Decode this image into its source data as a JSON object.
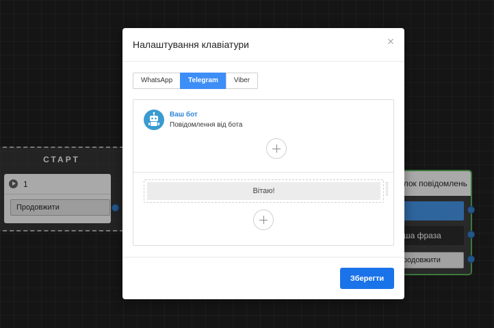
{
  "canvas": {
    "start_node": {
      "title": "СТАРТ",
      "step_number": "1",
      "continue_label": "Продовжити"
    },
    "right_node": {
      "header": "Блок повідомлень",
      "phrase": "Інша фраза",
      "continue_label": "Продовжити"
    }
  },
  "modal": {
    "title": "Налаштування клавіатури",
    "tabs": [
      {
        "label": "WhatsApp",
        "active": false
      },
      {
        "label": "Telegram",
        "active": true
      },
      {
        "label": "Viber",
        "active": false
      }
    ],
    "bot": {
      "name": "Ваш бот",
      "subtitle": "Повідомлення від бота",
      "avatar_icon": "robot-icon"
    },
    "keyboard_button_label": "Вітаю!",
    "save_label": "Зберегти"
  },
  "colors": {
    "accent": "#3e8ef7",
    "save": "#1a73e8",
    "bot_name": "#2e86d8",
    "avatar_bg": "#3a9bd0"
  }
}
